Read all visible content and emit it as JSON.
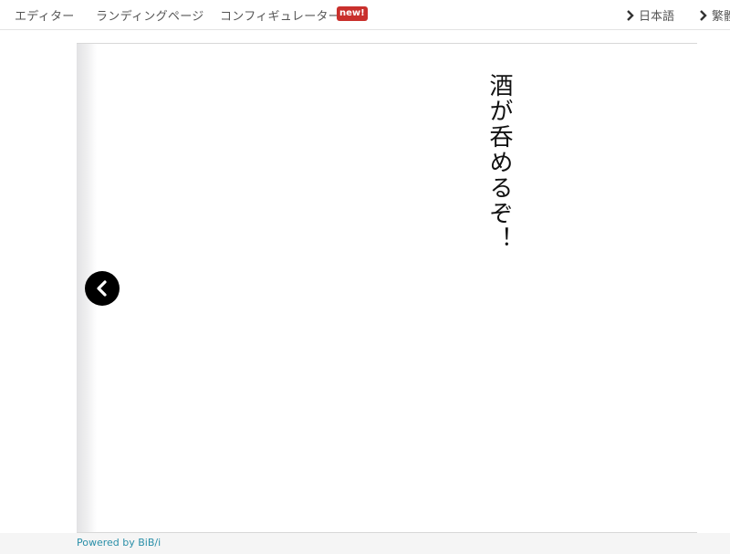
{
  "nav": {
    "items": [
      {
        "label": "エディター"
      },
      {
        "label": "ランディングページ"
      },
      {
        "label": "コンフィギュレーター"
      }
    ],
    "badge": "new!",
    "languages": [
      {
        "label": "日本語",
        "icon": "chevron-right-icon"
      },
      {
        "label": "繁體"
      }
    ]
  },
  "viewer": {
    "text": "酒が呑めるぞ！",
    "prev_icon": "chevron-left-icon"
  },
  "footer": {
    "powered": "Powered by BiB/i"
  },
  "colors": {
    "badge": "#c9302c",
    "link": "#2a8fa8",
    "nav_text": "#555555"
  }
}
